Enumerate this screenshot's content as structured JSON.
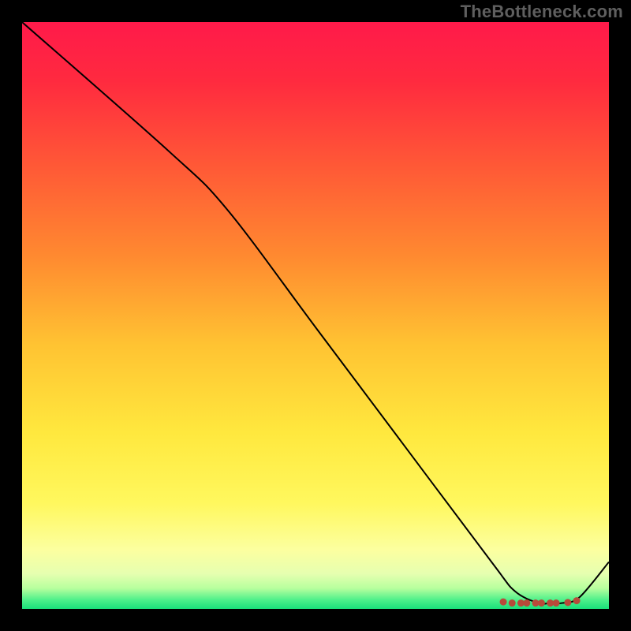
{
  "watermark": "TheBottleneck.com",
  "chart_data": {
    "type": "line",
    "title": "",
    "xlabel": "",
    "ylabel": "",
    "xlim": [
      0,
      100
    ],
    "ylim": [
      0,
      100
    ],
    "grid": false,
    "legend": false,
    "series": [
      {
        "name": "curve",
        "x": [
          0,
          25,
          35,
          50,
          65,
          80,
          84,
          88,
          90,
          92,
          95,
          100
        ],
        "values": [
          100,
          78,
          68,
          48,
          28,
          8,
          3,
          1,
          1,
          1,
          2,
          8
        ]
      }
    ],
    "markers": {
      "name": "dot-cluster",
      "x": [
        82,
        83.5,
        85,
        86,
        87.5,
        88.5,
        90,
        91,
        93,
        94.5
      ],
      "y": [
        1.2,
        1.0,
        1.0,
        1.0,
        1.0,
        1.0,
        1.0,
        1.0,
        1.1,
        1.4
      ],
      "color": "#b84a3a"
    },
    "background_gradient": {
      "stops": [
        {
          "offset": 0.0,
          "color": "#ff1a4a"
        },
        {
          "offset": 0.1,
          "color": "#ff2a3f"
        },
        {
          "offset": 0.25,
          "color": "#ff5a36"
        },
        {
          "offset": 0.4,
          "color": "#ff8a30"
        },
        {
          "offset": 0.55,
          "color": "#ffc332"
        },
        {
          "offset": 0.7,
          "color": "#ffe83e"
        },
        {
          "offset": 0.82,
          "color": "#fff85e"
        },
        {
          "offset": 0.9,
          "color": "#fcffa0"
        },
        {
          "offset": 0.94,
          "color": "#e6ffb0"
        },
        {
          "offset": 0.965,
          "color": "#b7ff9e"
        },
        {
          "offset": 0.985,
          "color": "#4cf08a"
        },
        {
          "offset": 1.0,
          "color": "#1adf7a"
        }
      ]
    },
    "line_color": "#000000",
    "line_width": 2
  }
}
